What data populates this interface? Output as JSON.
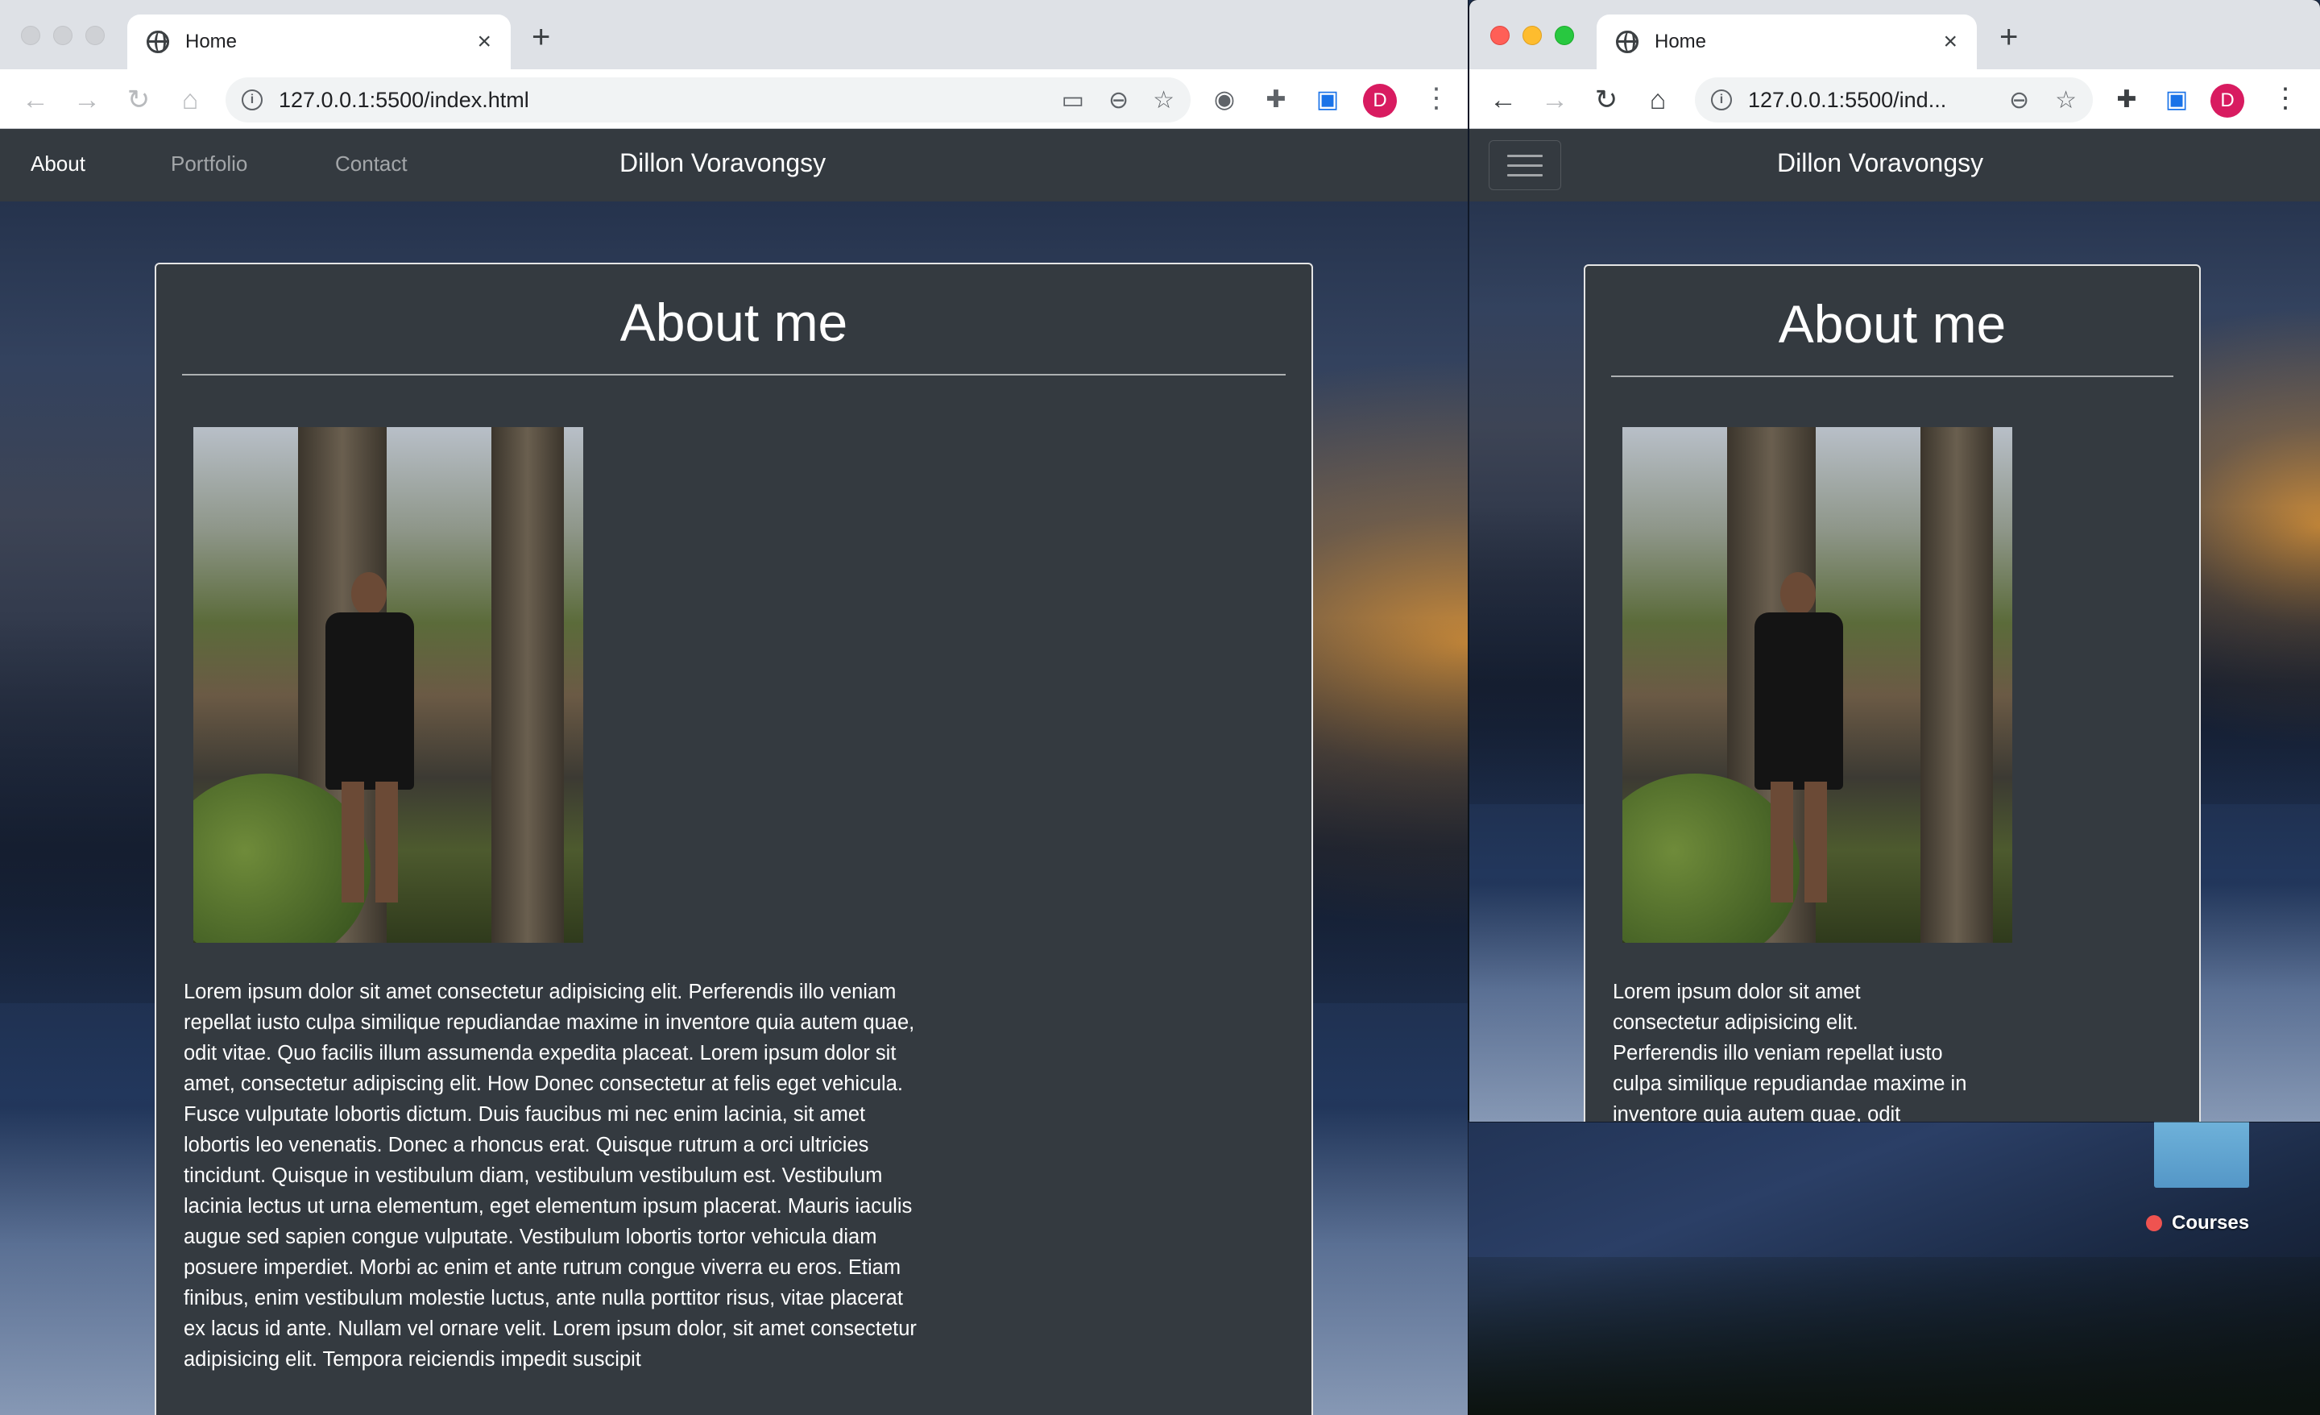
{
  "desktop": {
    "icon_label": "Courses",
    "icon_label_dot_color": "#ef5350"
  },
  "left_window": {
    "tab_title": "Home",
    "url": "127.0.0.1:5500/index.html",
    "avatar_letter": "D",
    "nav": {
      "links": [
        "About",
        "Portfolio",
        "Contact"
      ],
      "active": "About",
      "brand": "Dillon Voravongsy"
    },
    "card": {
      "heading": "About me",
      "body": "Lorem ipsum dolor sit amet consectetur adipisicing elit. Perferendis illo veniam repellat iusto culpa similique repudiandae maxime in inventore quia autem quae, odit vitae. Quo facilis illum assumenda expedita placeat. Lorem ipsum dolor sit amet, consectetur adipiscing elit. How Donec consectetur at felis eget vehicula. Fusce vulputate lobortis dictum. Duis faucibus mi nec enim lacinia, sit amet lobortis leo venenatis. Donec a rhoncus erat. Quisque rutrum a orci ultricies tincidunt. Quisque in vestibulum diam, vestibulum vestibulum est. Vestibulum lacinia lectus ut urna elementum, eget elementum ipsum placerat. Mauris iaculis augue sed sapien congue vulputate. Vestibulum lobortis tortor vehicula diam posuere imperdiet. Morbi ac enim et ante rutrum congue viverra eu eros. Etiam finibus, enim vestibulum molestie luctus, ante nulla porttitor risus, vitae placerat ex lacus id ante. Nullam vel ornare velit. Lorem ipsum dolor, sit amet consectetur adipisicing elit. Tempora reiciendis impedit suscipit"
    }
  },
  "right_window": {
    "tab_title": "Home",
    "url": "127.0.0.1:5500/ind...",
    "avatar_letter": "D",
    "nav": {
      "brand": "Dillon Voravongsy"
    },
    "card": {
      "heading": "About me",
      "body": "Lorem ipsum dolor sit amet consectetur adipisicing elit. Perferendis illo veniam repellat iusto culpa similique repudiandae maxime in inventore quia autem quae, odit"
    }
  },
  "colors": {
    "navbar": "#343a40",
    "avatar": "#d81b60",
    "tab_strip": "#dee1e6"
  }
}
